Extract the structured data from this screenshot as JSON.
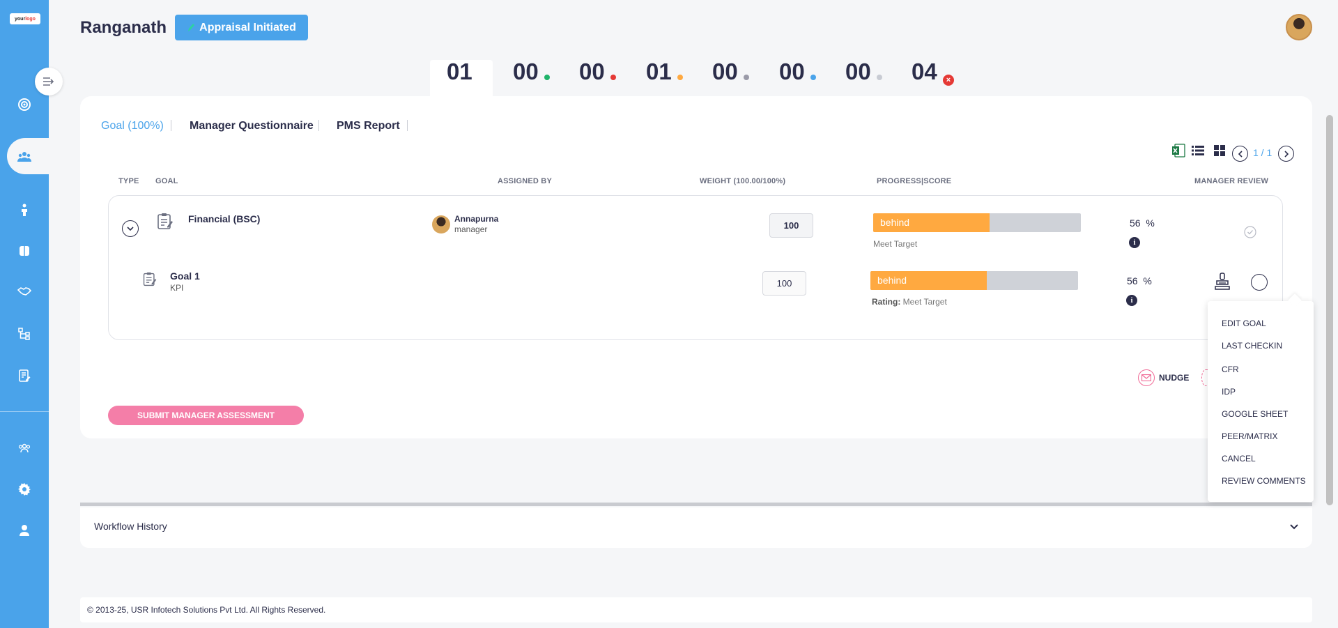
{
  "sidebar": {
    "logo_text": "your",
    "logo_accent": "logo",
    "icons": [
      "target-icon",
      "team-icon",
      "person-icon",
      "book-icon",
      "handshake-icon",
      "org-chart-icon",
      "document-edit-icon",
      "group-icon",
      "settings-icon",
      "user-profile-icon"
    ]
  },
  "header": {
    "title": "Ranganath",
    "status_label": "Appraisal Initiated"
  },
  "stats": {
    "values": [
      "01",
      "00",
      "00",
      "01",
      "00",
      "00",
      "00",
      "04"
    ],
    "dot_colors": [
      "",
      "#1fb36a",
      "#e53935",
      "#ffa940",
      "#9a9aa8",
      "#4aa3ea",
      "#c8cbd3",
      "#e53935"
    ]
  },
  "tabs": [
    {
      "label": "Goal (100%)",
      "active": true
    },
    {
      "label": "Manager Questionnaire",
      "active": false
    },
    {
      "label": "PMS Report",
      "active": false
    }
  ],
  "pager": {
    "text": "1 / 1"
  },
  "table": {
    "headers": {
      "type": "TYPE",
      "goal": "GOAL",
      "assigned_by": "ASSIGNED BY",
      "weight": "WEIGHT (100.00/100%)",
      "progress": "PROGRESS|SCORE",
      "manager_review": "MANAGER REVIEW"
    },
    "group": {
      "title": "Financial (BSC)",
      "assigned_name": "Annapurna",
      "assigned_role": "manager",
      "weight": "100",
      "progress_label": "behind",
      "progress_fraction": 0.56,
      "rating_value": "Meet Target",
      "score": "56",
      "score_unit": "%"
    },
    "goal": {
      "title": "Goal 1",
      "subtitle": "KPI",
      "weight": "100",
      "progress_label": "behind",
      "progress_fraction": 0.56,
      "rating_label": "Rating:",
      "rating_value": "Meet Target",
      "score": "56",
      "score_unit": "%"
    }
  },
  "menu": {
    "items": [
      "EDIT GOAL",
      "LAST CHECKIN",
      "CFR",
      "IDP",
      "GOOGLE SHEET",
      "PEER/MATRIX",
      "CANCEL",
      "REVIEW COMMENTS"
    ]
  },
  "actions": {
    "nudge": "NUDGE",
    "submit": "SUBMIT MANAGER ASSESSMENT"
  },
  "workflow": {
    "title": "Workflow History"
  },
  "footer": {
    "text": "© 2013-25, USR Infotech Solutions Pvt Ltd. All Rights Reserved."
  },
  "colors": {
    "accent": "#4aa3ea",
    "behind": "#ffa940",
    "submit": "#f47ea8",
    "text": "#2b2d4a"
  }
}
